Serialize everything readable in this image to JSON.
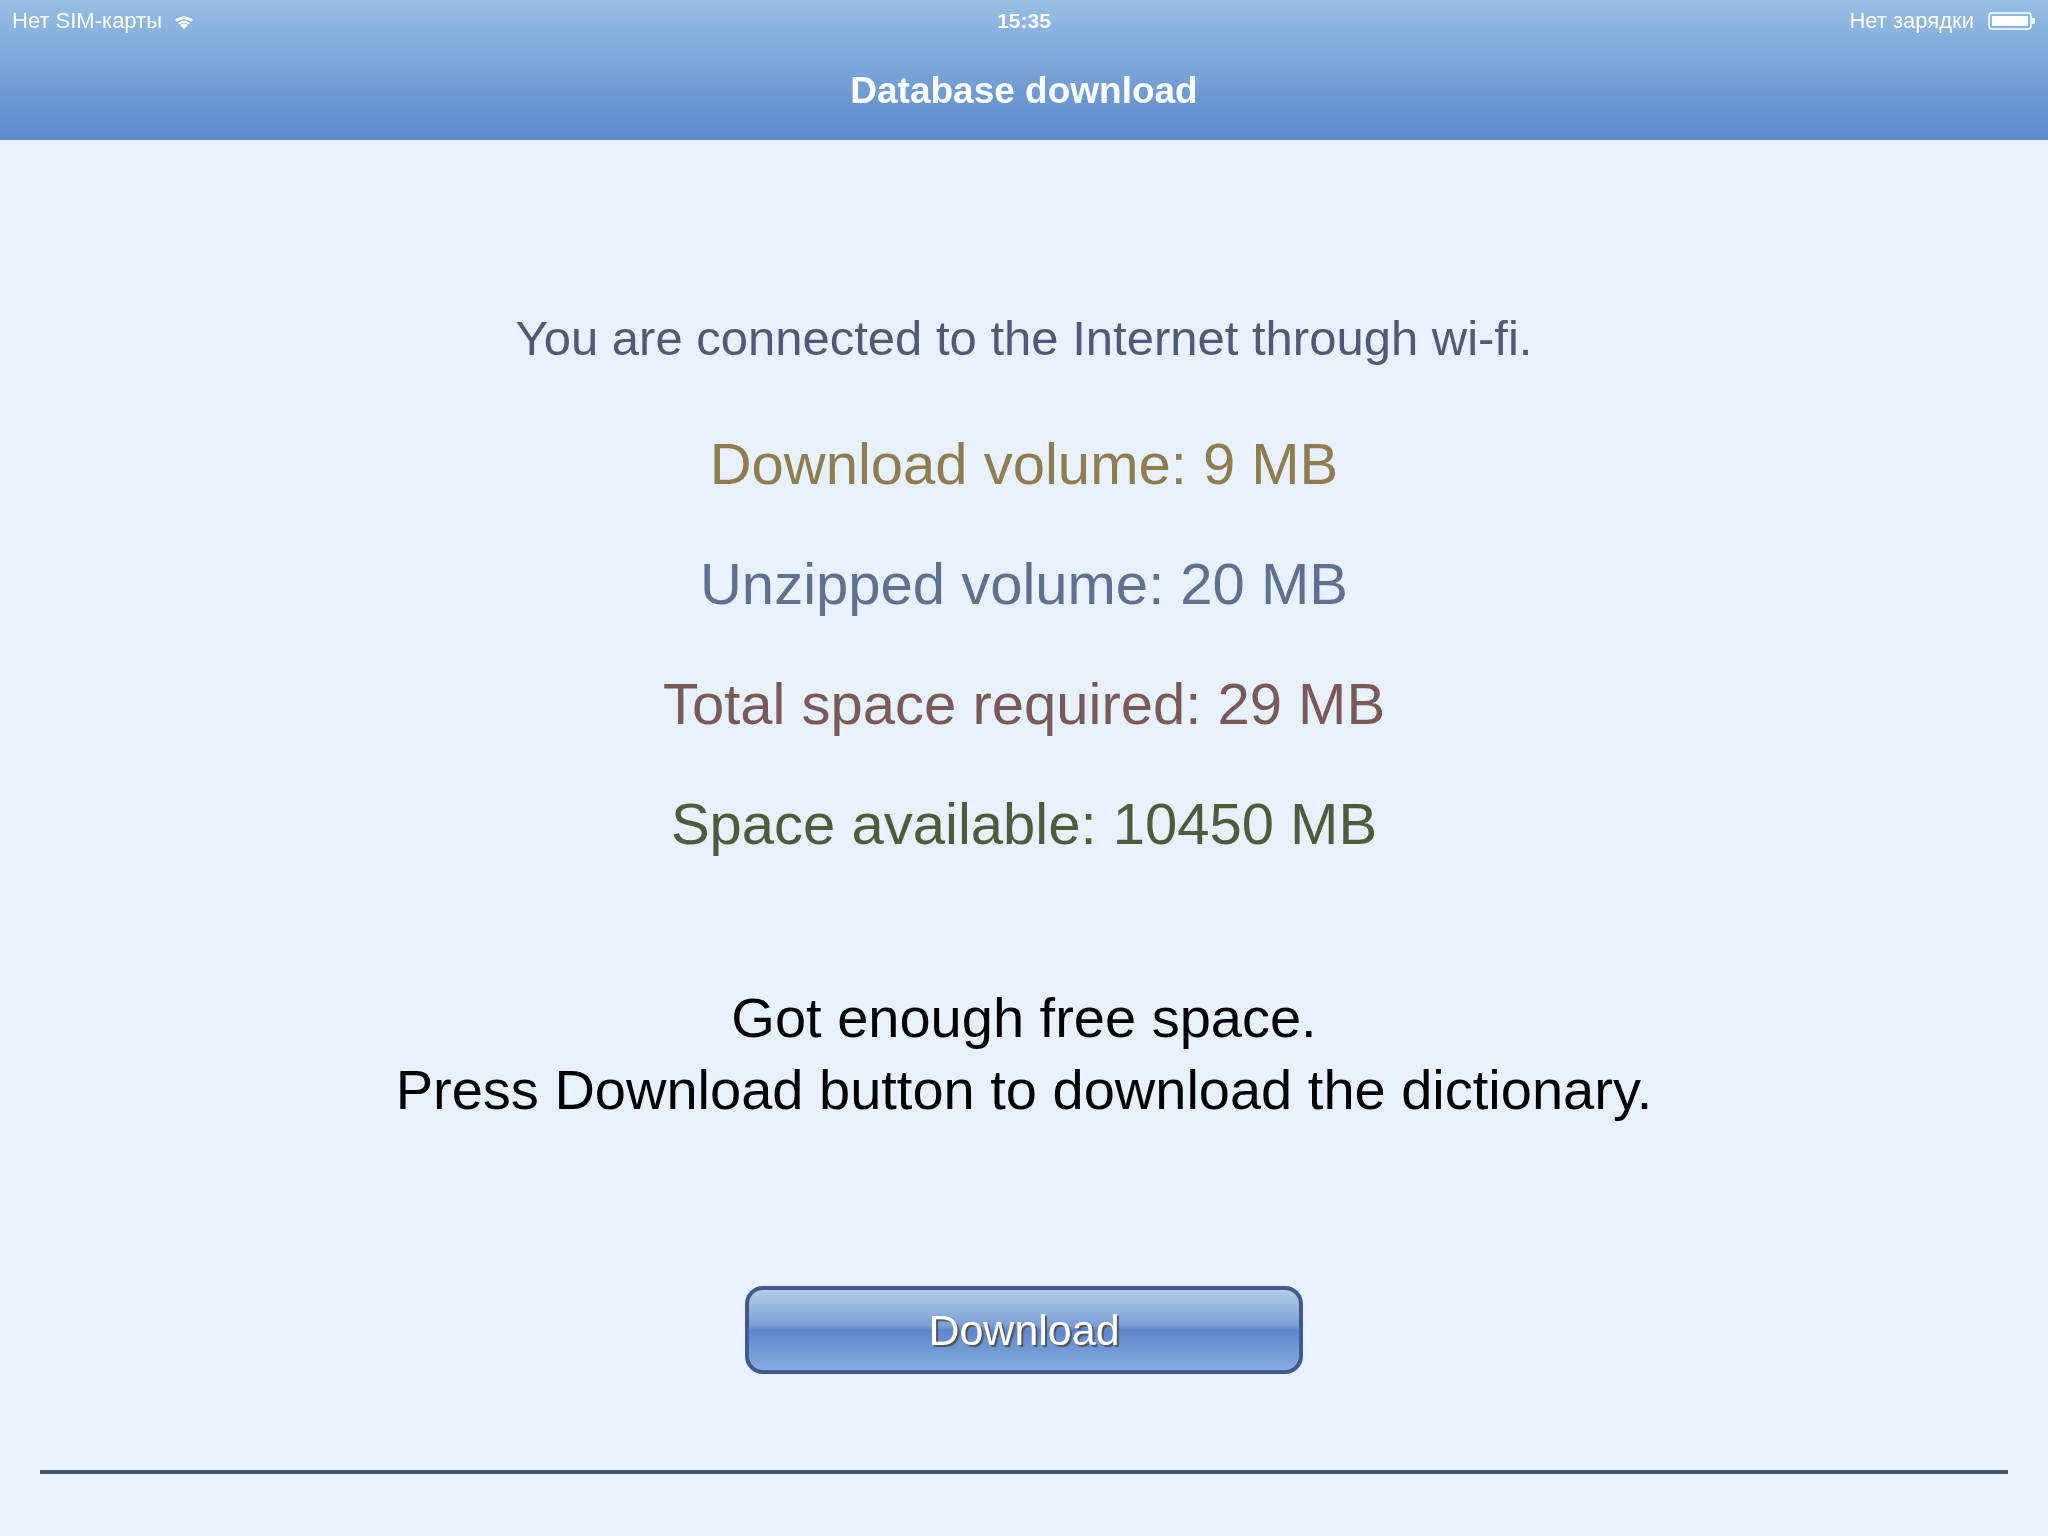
{
  "status_bar": {
    "carrier": "Нет SIM-карты",
    "time": "15:35",
    "charging": "Нет зарядки"
  },
  "navigation_bar": {
    "title": "Database download"
  },
  "connection_message": "You are connected to the Internet through wi-fi.",
  "stats": [
    {
      "text": "Download volume: 9 MB",
      "color": "#8f7d4f"
    },
    {
      "text": "Unzipped volume: 20 MB",
      "color": "#5f7090"
    },
    {
      "text": "Total space required: 29 MB",
      "color": "#7a5a58"
    },
    {
      "text": "Space available: 10450 MB",
      "color": "#4a5e3c"
    }
  ],
  "message_lines": [
    "Got enough free space.",
    "Press Download button to download the dictionary."
  ],
  "download_button": {
    "label": "Download"
  }
}
